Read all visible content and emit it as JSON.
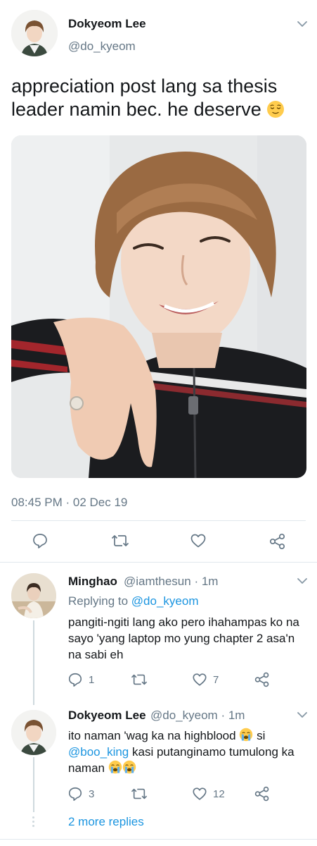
{
  "tweet": {
    "author_name": "Dokyeom Lee",
    "author_handle": "@do_kyeom",
    "text": "appreciation post lang sa thesis leader namin bec. he deserve",
    "emoji": "relieved-face-emoji",
    "timestamp": "08:45 PM · 02 Dec 19",
    "actions": {
      "reply_icon": "reply-icon",
      "retweet_icon": "retweet-icon",
      "like_icon": "heart-icon",
      "share_icon": "share-icon"
    }
  },
  "replies": [
    {
      "name": "Minghao",
      "handle": "@iamthesun",
      "time": "· 1m",
      "replying_prefix": "Replying to",
      "replying_to": "@do_kyeom",
      "text": "pangiti-ngiti lang ako pero ihahampas ko na sayo 'yang laptop mo yung chapter 2 asa'n na sabi eh",
      "reply_count": "1",
      "retweet_count": "",
      "like_count": "7"
    },
    {
      "name": "Dokyeom Lee",
      "handle": "@do_kyeom",
      "time": "· 1m",
      "text_part1": "ito naman 'wag ka na highblood",
      "text_part2": "si",
      "mention": "@boo_king",
      "text_part3": "kasi putanginamo tumulong ka naman",
      "reply_count": "3",
      "retweet_count": "",
      "like_count": "12"
    }
  ],
  "more_replies": "2 more replies",
  "colors": {
    "link": "#1b95e0",
    "secondary_text": "#657786",
    "divider": "#e1e8ed"
  }
}
